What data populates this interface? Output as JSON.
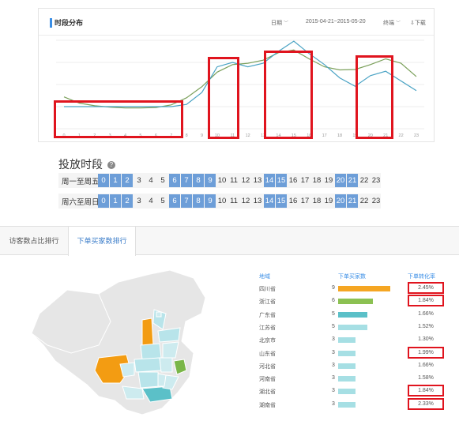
{
  "time_panel": {
    "title": "时段分布",
    "date_label": "日期",
    "date_range": "2015-04-21~2015-05-20",
    "metric_label": "终端",
    "download_label": "下载"
  },
  "chart_data": {
    "type": "line",
    "x": [
      "0",
      "1",
      "2",
      "3",
      "4",
      "5",
      "6",
      "7",
      "8",
      "9",
      "10",
      "11",
      "12",
      "13",
      "14",
      "15",
      "16",
      "17",
      "18",
      "19",
      "20",
      "21",
      "22",
      "23"
    ],
    "series": [
      {
        "color": "#7ba05b",
        "values": [
          72,
          58,
          52,
          49,
          47,
          47,
          48,
          54,
          70,
          95,
          128,
          145,
          148,
          155,
          172,
          178,
          158,
          140,
          133,
          134,
          145,
          158,
          148,
          118
        ]
      },
      {
        "color": "#4aa3c4",
        "values": [
          50,
          50,
          50,
          50,
          50,
          50,
          50,
          50,
          55,
          82,
          140,
          150,
          140,
          148,
          175,
          198,
          170,
          145,
          115,
          96,
          120,
          130,
          108,
          86
        ]
      }
    ],
    "grid": true
  },
  "time_slots": {
    "title": "投放时段",
    "rows": [
      {
        "label": "周一至周五",
        "active": [
          0,
          1,
          2,
          6,
          7,
          8,
          9,
          14,
          15,
          20,
          21
        ]
      },
      {
        "label": "周六至周日",
        "active": [
          0,
          1,
          2,
          6,
          7,
          8,
          9,
          14,
          15,
          20,
          21
        ]
      }
    ],
    "hours": [
      "0",
      "1",
      "2",
      "3",
      "4",
      "5",
      "6",
      "7",
      "8",
      "9",
      "10",
      "11",
      "12",
      "13",
      "14",
      "15",
      "16",
      "17",
      "18",
      "19",
      "20",
      "21",
      "22",
      "23"
    ]
  },
  "rank_panel": {
    "tabs": [
      "访客数占比排行",
      "下单买家数排行"
    ],
    "active_tab": 1,
    "headers": {
      "region": "地域",
      "buyers": "下单买家数",
      "rate": "下单转化率"
    },
    "rows": [
      {
        "region": "四川省",
        "buyers": "9",
        "bar": 9,
        "color": "#f5a623",
        "rate": "2.45%",
        "flagged": true
      },
      {
        "region": "浙江省",
        "buyers": "6",
        "bar": 6,
        "color": "#8cc152",
        "rate": "1.84%",
        "flagged": true
      },
      {
        "region": "广东省",
        "buyers": "5",
        "bar": 5,
        "color": "#5bc0c8",
        "rate": "1.66%",
        "flagged": false
      },
      {
        "region": "江苏省",
        "buyers": "5",
        "bar": 5,
        "color": "#a6dfe4",
        "rate": "1.52%",
        "flagged": false
      },
      {
        "region": "北京市",
        "buyers": "3",
        "bar": 3,
        "color": "#a6dfe4",
        "rate": "1.30%",
        "flagged": false
      },
      {
        "region": "山东省",
        "buyers": "3",
        "bar": 3,
        "color": "#a6dfe4",
        "rate": "1.99%",
        "flagged": true
      },
      {
        "region": "河北省",
        "buyers": "3",
        "bar": 3,
        "color": "#a6dfe4",
        "rate": "1.66%",
        "flagged": false
      },
      {
        "region": "河南省",
        "buyers": "3",
        "bar": 3,
        "color": "#a6dfe4",
        "rate": "1.58%",
        "flagged": false
      },
      {
        "region": "湖北省",
        "buyers": "3",
        "bar": 3,
        "color": "#a6dfe4",
        "rate": "1.84%",
        "flagged": true
      },
      {
        "region": "湖南省",
        "buyers": "3",
        "bar": 3,
        "color": "#a6dfe4",
        "rate": "2.33%",
        "flagged": true
      }
    ]
  }
}
